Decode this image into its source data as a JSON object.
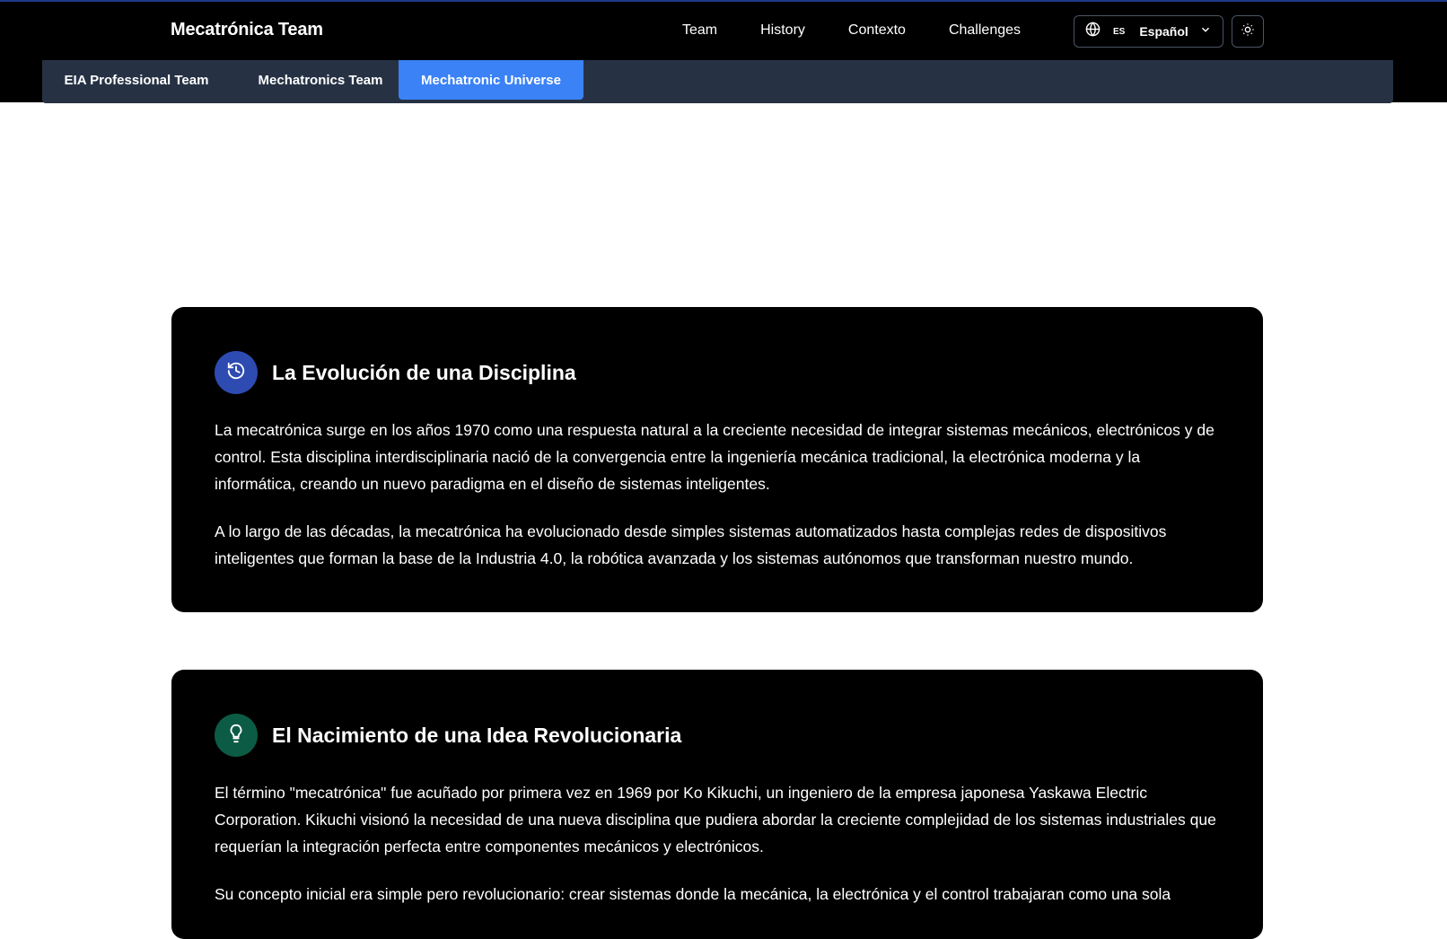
{
  "header": {
    "brand": "Mecatrónica Team",
    "nav": [
      {
        "label": "Team"
      },
      {
        "label": "History"
      },
      {
        "label": "Contexto"
      },
      {
        "label": "Challenges"
      }
    ],
    "language": {
      "code": "ES",
      "name": "Español",
      "icon": "globe-icon"
    },
    "theme_toggle_icon": "sun-icon"
  },
  "subnav": {
    "tabs": [
      {
        "label": "EIA Professional Team",
        "active": false
      },
      {
        "label": "Mechatronics Team",
        "active": false
      },
      {
        "label": "Mechatronic Universe",
        "active": true
      }
    ],
    "active_color": "#3b82f6"
  },
  "sections": [
    {
      "icon": "history-icon",
      "icon_color": "#2d4bb0",
      "title": "La Evolución de una Disciplina",
      "paragraphs": [
        "La mecatrónica surge en los años 1970 como una respuesta natural a la creciente necesidad de integrar sistemas mecánicos, electrónicos y de control. Esta disciplina interdisciplinaria nació de la convergencia entre la ingeniería mecánica tradicional, la electrónica moderna y la informática, creando un nuevo paradigma en el diseño de sistemas inteligentes.",
        "A lo largo de las décadas, la mecatrónica ha evolucionado desde simples sistemas automatizados hasta complejas redes de dispositivos inteligentes que forman la base de la Industria 4.0, la robótica avanzada y los sistemas autónomos que transforman nuestro mundo."
      ]
    },
    {
      "icon": "lightbulb-icon",
      "icon_color": "#0c5c45",
      "title": "El Nacimiento de una Idea Revolucionaria",
      "paragraphs": [
        "El término \"mecatrónica\" fue acuñado por primera vez en 1969 por Ko Kikuchi, un ingeniero de la empresa japonesa Yaskawa Electric Corporation. Kikuchi visionó la necesidad de una nueva disciplina que pudiera abordar la creciente complejidad de los sistemas industriales que requerían la integración perfecta entre componentes mecánicos y electrónicos.",
        "Su concepto inicial era simple pero revolucionario: crear sistemas donde la mecánica, la electrónica y el control trabajaran como una sola"
      ]
    }
  ]
}
